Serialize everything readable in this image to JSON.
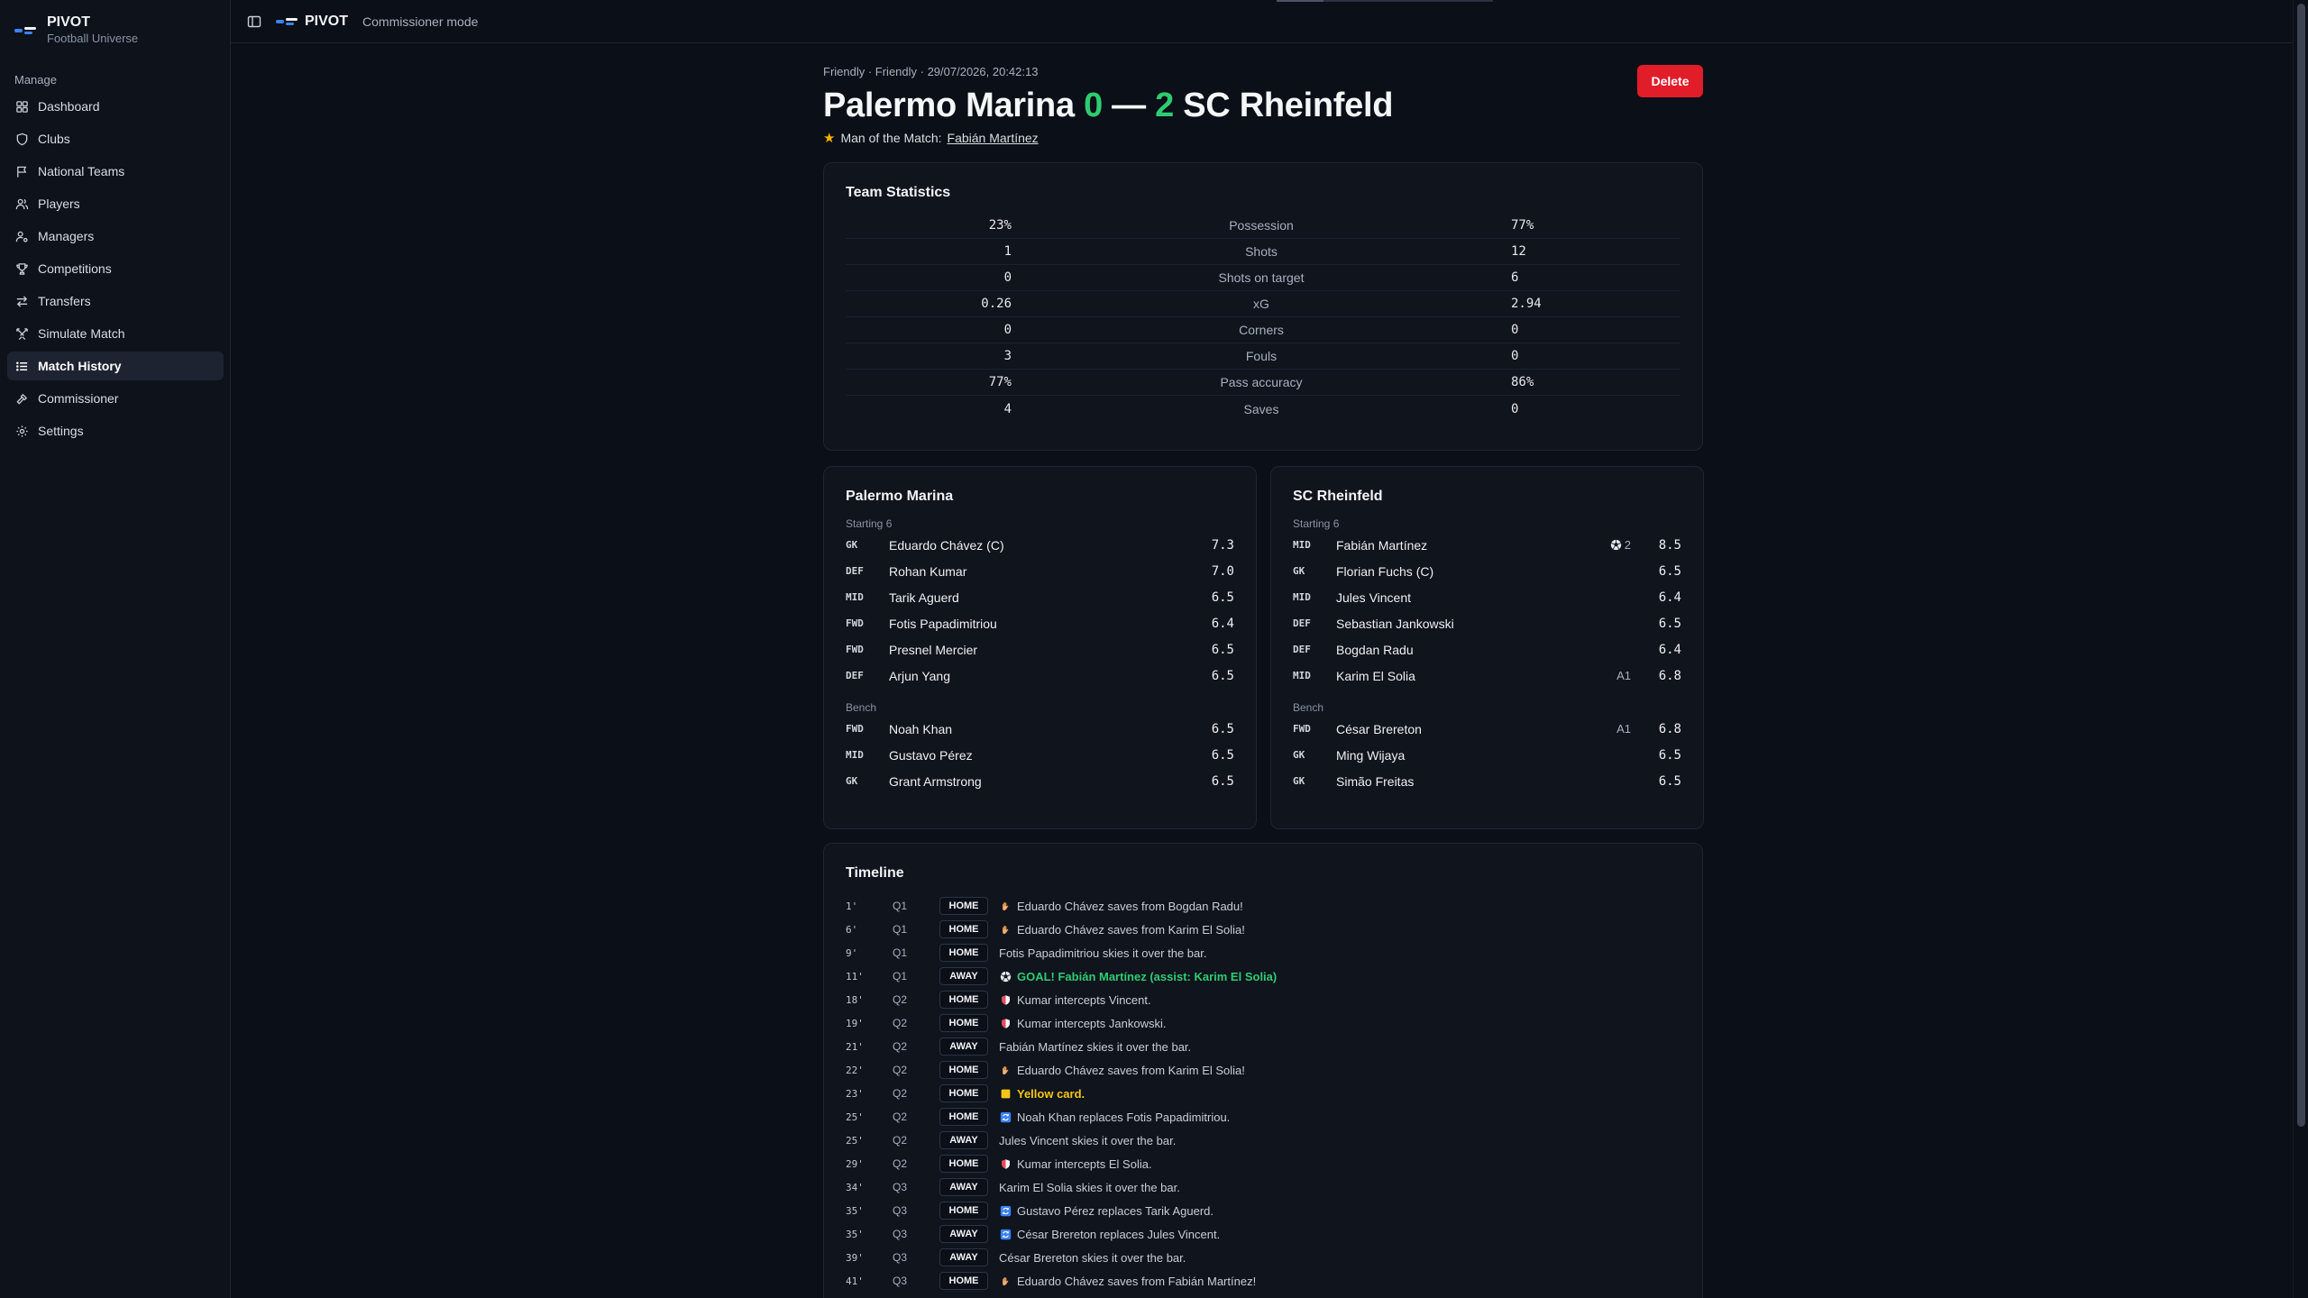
{
  "app": {
    "name": "PIVOT",
    "subtitle": "Football Universe",
    "mode": "Commissioner mode",
    "brand_colors": [
      "#3b82f6",
      "#f2f4f7"
    ]
  },
  "sidebar": {
    "group_label": "Manage",
    "items": [
      {
        "label": "Dashboard",
        "icon": "grid-icon"
      },
      {
        "label": "Clubs",
        "icon": "shield-icon"
      },
      {
        "label": "National Teams",
        "icon": "flag-icon"
      },
      {
        "label": "Players",
        "icon": "users-icon"
      },
      {
        "label": "Managers",
        "icon": "user-cog-icon"
      },
      {
        "label": "Competitions",
        "icon": "trophy-icon"
      },
      {
        "label": "Transfers",
        "icon": "arrows-icon"
      },
      {
        "label": "Simulate Match",
        "icon": "swords-icon"
      },
      {
        "label": "Match History",
        "icon": "list-icon",
        "active": true
      },
      {
        "label": "Commissioner",
        "icon": "hammer-icon"
      },
      {
        "label": "Settings",
        "icon": "gear-icon"
      }
    ]
  },
  "match": {
    "meta": "Friendly · Friendly · 29/07/2026, 20:42:13",
    "home_team": "Palermo Marina",
    "home_score": "0",
    "separator": "—",
    "away_score": "2",
    "away_team": "SC Rheinfeld",
    "motm_label": "Man of the Match:",
    "motm_player": "Fabián Martínez",
    "delete_label": "Delete"
  },
  "stats": {
    "title": "Team Statistics",
    "rows": [
      {
        "home": "23%",
        "label": "Possession",
        "away": "77%"
      },
      {
        "home": "1",
        "label": "Shots",
        "away": "12"
      },
      {
        "home": "0",
        "label": "Shots on target",
        "away": "6"
      },
      {
        "home": "0.26",
        "label": "xG",
        "away": "2.94"
      },
      {
        "home": "0",
        "label": "Corners",
        "away": "0"
      },
      {
        "home": "3",
        "label": "Fouls",
        "away": "0"
      },
      {
        "home": "77%",
        "label": "Pass accuracy",
        "away": "86%"
      },
      {
        "home": "4",
        "label": "Saves",
        "away": "0"
      }
    ]
  },
  "lineups": {
    "starting_label": "Starting 6",
    "bench_label": "Bench",
    "home": {
      "team": "Palermo Marina",
      "starting": [
        {
          "pos": "GK",
          "name": "Eduardo Chávez (C)",
          "extra": "",
          "rating": "7.3"
        },
        {
          "pos": "DEF",
          "name": "Rohan Kumar",
          "extra": "",
          "rating": "7.0"
        },
        {
          "pos": "MID",
          "name": "Tarik Aguerd",
          "extra": "",
          "rating": "6.5"
        },
        {
          "pos": "FWD",
          "name": "Fotis Papadimitriou",
          "extra": "",
          "rating": "6.4"
        },
        {
          "pos": "FWD",
          "name": "Presnel Mercier",
          "extra": "",
          "rating": "6.5"
        },
        {
          "pos": "DEF",
          "name": "Arjun Yang",
          "extra": "",
          "rating": "6.5"
        }
      ],
      "bench": [
        {
          "pos": "FWD",
          "name": "Noah Khan",
          "extra": "",
          "rating": "6.5"
        },
        {
          "pos": "MID",
          "name": "Gustavo Pérez",
          "extra": "",
          "rating": "6.5"
        },
        {
          "pos": "GK",
          "name": "Grant Armstrong",
          "extra": "",
          "rating": "6.5"
        }
      ]
    },
    "away": {
      "team": "SC Rheinfeld",
      "starting": [
        {
          "pos": "MID",
          "name": "Fabián Martínez",
          "extra": "2",
          "extra_icon": "ball-icon",
          "rating": "8.5"
        },
        {
          "pos": "GK",
          "name": "Florian Fuchs (C)",
          "extra": "",
          "rating": "6.5"
        },
        {
          "pos": "MID",
          "name": "Jules Vincent",
          "extra": "",
          "rating": "6.4"
        },
        {
          "pos": "DEF",
          "name": "Sebastian Jankowski",
          "extra": "",
          "rating": "6.5"
        },
        {
          "pos": "DEF",
          "name": "Bogdan Radu",
          "extra": "",
          "rating": "6.4"
        },
        {
          "pos": "MID",
          "name": "Karim El Solia",
          "extra": "A1",
          "rating": "6.8"
        }
      ],
      "bench": [
        {
          "pos": "FWD",
          "name": "César Brereton",
          "extra": "A1",
          "rating": "6.8"
        },
        {
          "pos": "GK",
          "name": "Ming Wijaya",
          "extra": "",
          "rating": "6.5"
        },
        {
          "pos": "GK",
          "name": "Simão Freitas",
          "extra": "",
          "rating": "6.5"
        }
      ]
    }
  },
  "timeline": {
    "title": "Timeline",
    "events": [
      {
        "min": "1'",
        "q": "Q1",
        "side": "HOME",
        "type": "save",
        "text": "Eduardo Chávez saves from Bogdan Radu!"
      },
      {
        "min": "6'",
        "q": "Q1",
        "side": "HOME",
        "type": "save",
        "text": "Eduardo Chávez saves from Karim El Solia!"
      },
      {
        "min": "9'",
        "q": "Q1",
        "side": "HOME",
        "type": "miss",
        "text": "Fotis Papadimitriou skies it over the bar."
      },
      {
        "min": "11'",
        "q": "Q1",
        "side": "AWAY",
        "type": "goal",
        "text": "GOAL! Fabián Martínez (assist: Karim El Solia)"
      },
      {
        "min": "18'",
        "q": "Q2",
        "side": "HOME",
        "type": "intercept",
        "text": "Kumar intercepts Vincent."
      },
      {
        "min": "19'",
        "q": "Q2",
        "side": "HOME",
        "type": "intercept",
        "text": "Kumar intercepts Jankowski."
      },
      {
        "min": "21'",
        "q": "Q2",
        "side": "AWAY",
        "type": "miss",
        "text": "Fabián Martínez skies it over the bar."
      },
      {
        "min": "22'",
        "q": "Q2",
        "side": "HOME",
        "type": "save",
        "text": "Eduardo Chávez saves from Karim El Solia!"
      },
      {
        "min": "23'",
        "q": "Q2",
        "side": "HOME",
        "type": "yellow",
        "text": "Yellow card."
      },
      {
        "min": "25'",
        "q": "Q2",
        "side": "HOME",
        "type": "sub",
        "text": "Noah Khan replaces Fotis Papadimitriou."
      },
      {
        "min": "25'",
        "q": "Q2",
        "side": "AWAY",
        "type": "miss",
        "text": "Jules Vincent skies it over the bar."
      },
      {
        "min": "29'",
        "q": "Q2",
        "side": "HOME",
        "type": "intercept",
        "text": "Kumar intercepts El Solia."
      },
      {
        "min": "34'",
        "q": "Q3",
        "side": "AWAY",
        "type": "miss",
        "text": "Karim El Solia skies it over the bar."
      },
      {
        "min": "35'",
        "q": "Q3",
        "side": "HOME",
        "type": "sub",
        "text": "Gustavo Pérez replaces Tarik Aguerd."
      },
      {
        "min": "35'",
        "q": "Q3",
        "side": "AWAY",
        "type": "sub",
        "text": "César Brereton replaces Jules Vincent."
      },
      {
        "min": "39'",
        "q": "Q3",
        "side": "AWAY",
        "type": "miss",
        "text": "César Brereton skies it over the bar."
      },
      {
        "min": "41'",
        "q": "Q3",
        "side": "HOME",
        "type": "save",
        "text": "Eduardo Chávez saves from Fabián Martínez!"
      }
    ]
  }
}
